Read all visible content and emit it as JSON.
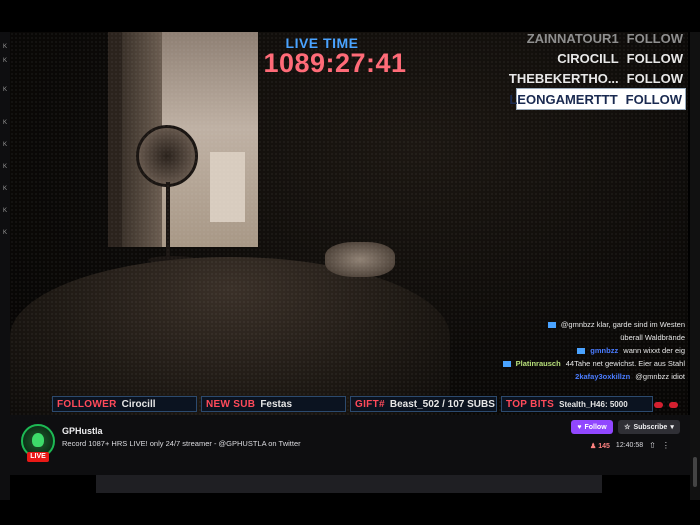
{
  "overlay": {
    "live_label": "LIVE TIME",
    "live_time": "1089:27:41"
  },
  "follow_list": [
    {
      "name": "ZAINNATOUR1",
      "action": "FOLLOW",
      "state": "faded"
    },
    {
      "name": "CIROCILL",
      "action": "FOLLOW",
      "state": "normal"
    },
    {
      "name": "THEBEKERTHO...",
      "action": "FOLLOW",
      "state": "normal"
    },
    {
      "name": "LEONGAMERTTT",
      "action": "FOLLOW",
      "state": "active"
    }
  ],
  "chat": [
    {
      "user": "",
      "message": "@gmnbzz klar, garde sind im Westen"
    },
    {
      "user": "",
      "message": "überall Waldbrände"
    },
    {
      "user": "gmnbzz",
      "message": "wann wixxt der eig"
    },
    {
      "user": "Platinrausch",
      "message": "44Tahe net gewichst. Eier aus Stahl"
    },
    {
      "user": "2kafay3oxkillzn",
      "message": "@gmnbzz idiot"
    }
  ],
  "ticker": {
    "follower_label": "FOLLOWER",
    "follower_value": "Cirocill",
    "newsub_label": "NEW SUB",
    "newsub_value": "Festas",
    "gift_label": "GIFT#",
    "gift_value": "Beast_502 / 107 SUBS",
    "topbits_label": "TOP BITS",
    "topbits_value": "Stealth_H46: 5000"
  },
  "channel": {
    "name": "GPHustla",
    "live_badge": "LIVE",
    "title": "Record 1087+ HRS LIVE! only 24/7 streamer - @GPHUSTLA on Twitter",
    "follow_label": "Follow",
    "subscribe_label": "Subscribe",
    "viewers": "145",
    "uptime": "12:40:58"
  },
  "left_rail": [
    "K",
    "K",
    "K",
    "K",
    "K",
    "K",
    "K",
    "K",
    "K"
  ],
  "icons": {
    "heart": "heart-icon",
    "star": "star-icon",
    "person": "viewers-icon",
    "share": "share-icon",
    "more": "more-icon"
  },
  "colors": {
    "accent": "#9147ff",
    "live": "#e91916",
    "live_time": "#ff6b78",
    "live_label": "#4aa3ff"
  }
}
